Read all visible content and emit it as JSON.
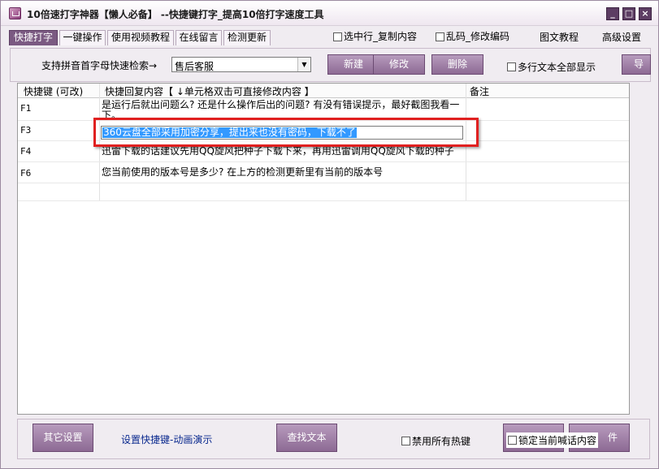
{
  "window": {
    "title": "10倍速打字神器【懒人必备】 --快捷键打字_提高10倍打字速度工具",
    "minimize_label": "_",
    "maximize_label": "□",
    "close_label": "×"
  },
  "menubar": {
    "tabs": [
      {
        "label": "快捷打字",
        "active": true
      },
      {
        "label": "一键操作",
        "active": false
      },
      {
        "label": "使用视频教程",
        "active": false
      },
      {
        "label": "在线留言",
        "active": false
      },
      {
        "label": "检测更新",
        "active": false
      }
    ],
    "checkboxes": [
      {
        "label": "选中行_复制内容",
        "checked": false
      },
      {
        "label": "乱码_修改编码",
        "checked": false
      }
    ],
    "links": [
      "图文教程",
      "高级设置"
    ]
  },
  "toolbar": {
    "search_label": "支持拼音首字母快速检索→",
    "category_value": "售后客服",
    "new_label": "新建",
    "edit_label": "修改",
    "delete_label": "删除",
    "multiline_label": "多行文本全部显示",
    "more_label": "导"
  },
  "grid": {
    "columns": [
      "快捷键 (可改)",
      "快捷回复内容【 ↓单元格双击可直接修改内容 】",
      "备注"
    ],
    "rows": [
      {
        "key": "F1",
        "reply": "是运行后就出问题么? 还是什么操作后出的问题? 有没有错误提示，最好截图我看一下。",
        "note": ""
      },
      {
        "key": "F3",
        "reply": "360云盘全部采用加密分享，提出来也没有密码，下载不了",
        "note": "",
        "editing": true
      },
      {
        "key": "F4",
        "reply": "迅雷下载的话建议先用QQ旋风把种子下载下来，再用迅雷调用QQ旋风下载的种子",
        "note": ""
      },
      {
        "key": "F6",
        "reply": "您当前使用的版本号是多少? 在上方的检测更新里有当前的版本号",
        "note": ""
      },
      {
        "key": "",
        "reply": "",
        "note": ""
      }
    ]
  },
  "bottom": {
    "other_settings_label": "其它设置",
    "hotkey_demo_link": "设置快捷键-动画演示",
    "find_text_label": "查找文本",
    "disable_hotkeys_label": "禁用所有热键",
    "lock_content_label": "锁定当前喊话内容",
    "right_button_label": "件"
  },
  "colors": {
    "accent": "#7b5a82",
    "button": "#9b7ba2",
    "selection": "#3399ff",
    "highlight_border": "#e02020",
    "link": "#0b2a8f"
  }
}
